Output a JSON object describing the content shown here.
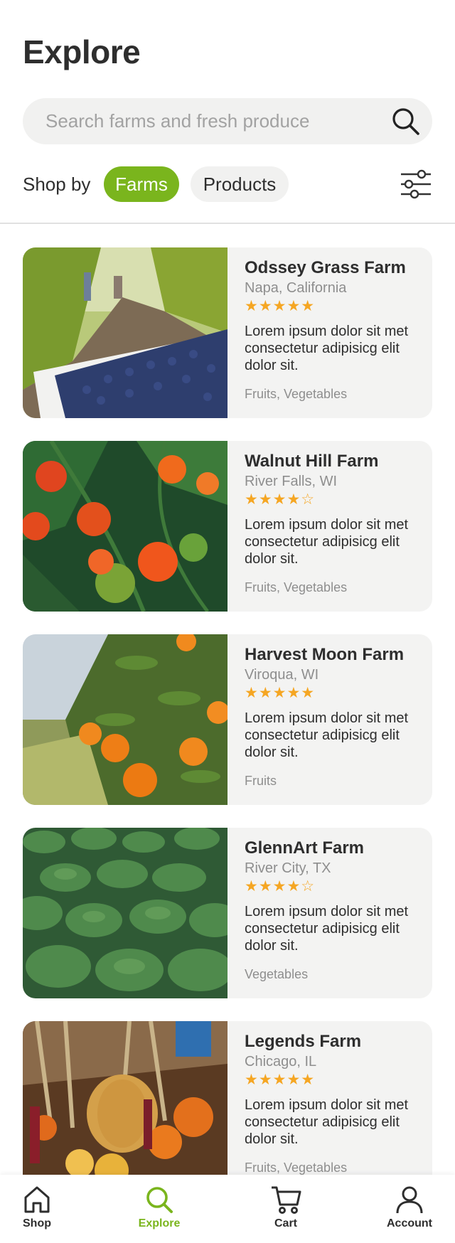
{
  "header": {
    "title": "Explore"
  },
  "search": {
    "placeholder": "Search farms and fresh produce",
    "icon": "search-icon"
  },
  "shop_by": {
    "label": "Shop by",
    "options": [
      {
        "label": "Farms",
        "active": true
      },
      {
        "label": "Products",
        "active": false
      }
    ],
    "filter_icon": "sliders-icon"
  },
  "colors": {
    "accent": "#7ab51d",
    "star": "#f5a623",
    "card_bg": "#f3f3f2"
  },
  "farms": [
    {
      "name": "Odssey Grass Farm",
      "location": "Napa, California",
      "rating": 5,
      "stars": "★★★★★",
      "description": "Lorem ipsum dolor sit met consectetur adipisicg elit dolor sit.",
      "tags": "Fruits, Vegetables",
      "image": "grapes-photo"
    },
    {
      "name": "Walnut Hill Farm",
      "location": "River Falls, WI",
      "rating": 4,
      "stars": "★★★★☆",
      "description": "Lorem ipsum dolor sit met consectetur adipisicg elit dolor sit.",
      "tags": "Fruits, Vegetables",
      "image": "tomatoes-photo"
    },
    {
      "name": "Harvest Moon Farm",
      "location": "Viroqua, WI",
      "rating": 5,
      "stars": "★★★★★",
      "description": "Lorem ipsum dolor sit met consectetur adipisicg elit dolor sit.",
      "tags": "Fruits",
      "image": "oranges-photo"
    },
    {
      "name": "GlennArt Farm",
      "location": "River City, TX",
      "rating": 4,
      "stars": "★★★★☆",
      "description": "Lorem ipsum dolor sit met consectetur adipisicg elit dolor sit.",
      "tags": "Vegetables",
      "image": "lettuce-photo"
    },
    {
      "name": "Legends Farm",
      "location": "Chicago, IL",
      "rating": 5,
      "stars": "★★★★★",
      "description": "Lorem ipsum dolor sit met consectetur adipisicg elit dolor sit.",
      "tags": "Fruits, Vegetables",
      "image": "pumpkins-photo"
    }
  ],
  "tabbar": {
    "tabs": [
      {
        "label": "Shop",
        "icon": "home-icon",
        "active": false
      },
      {
        "label": "Explore",
        "icon": "search-icon",
        "active": true
      },
      {
        "label": "Cart",
        "icon": "cart-icon",
        "active": false
      },
      {
        "label": "Account",
        "icon": "user-icon",
        "active": false
      }
    ]
  }
}
